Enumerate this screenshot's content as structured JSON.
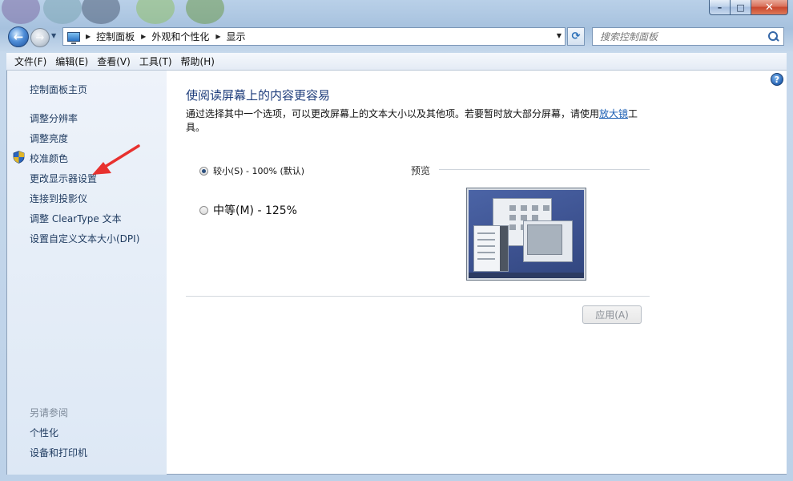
{
  "window": {
    "caption": {
      "minimize": "–",
      "maximize": "□",
      "close": "✕"
    }
  },
  "address": {
    "crumbs": [
      "控制面板",
      "外观和个性化",
      "显示"
    ],
    "search_placeholder": "搜索控制面板"
  },
  "menu": [
    "文件(F)",
    "编辑(E)",
    "查看(V)",
    "工具(T)",
    "帮助(H)"
  ],
  "sidebar": {
    "home": "控制面板主页",
    "links": [
      "调整分辨率",
      "调整亮度",
      "校准颜色",
      "更改显示器设置",
      "连接到投影仪",
      "调整 ClearType 文本",
      "设置自定义文本大小(DPI)"
    ],
    "see_also_title": "另请参阅",
    "see_also": [
      "个性化",
      "设备和打印机"
    ]
  },
  "main": {
    "title": "使阅读屏幕上的内容更容易",
    "desc_before": "通过选择其中一个选项，可以更改屏幕上的文本大小以及其他项。若要暂时放大部分屏幕，请使用",
    "desc_link": "放大镜",
    "desc_after": "工具。",
    "options": [
      {
        "label": "较小(S) - 100% (默认)",
        "checked": true
      },
      {
        "label": "中等(M) - 125%",
        "checked": false
      }
    ],
    "preview_label": "预览",
    "apply_label": "应用(A)",
    "help_glyph": "?"
  },
  "icons": {
    "back": "back-arrow-icon",
    "forward": "forward-arrow-icon",
    "refresh": "refresh-icon",
    "search": "search-icon",
    "shield": "uac-shield-icon",
    "help": "help-icon"
  },
  "colors": {
    "link": "#1e3a5f",
    "title": "#1e3d7b",
    "annotation_arrow": "#e8312f"
  }
}
